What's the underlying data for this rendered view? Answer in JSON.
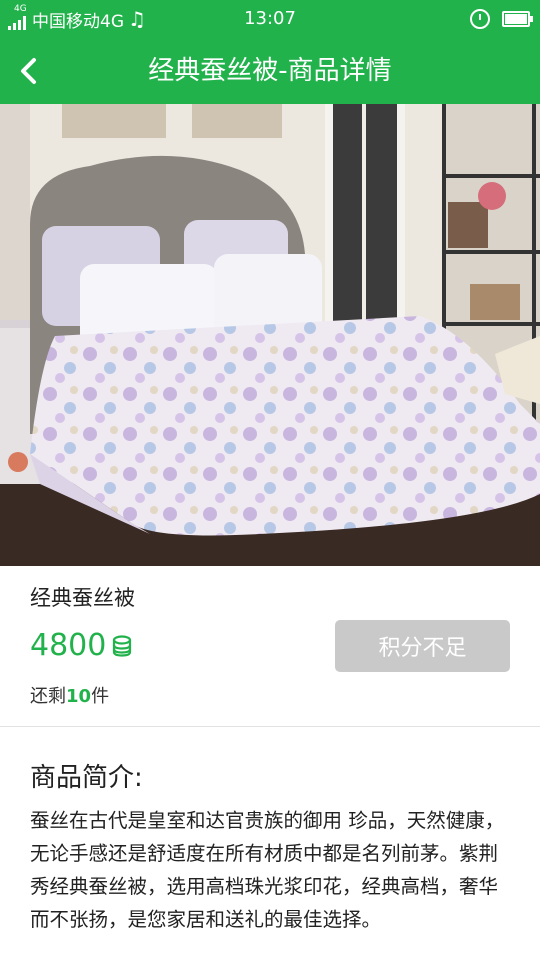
{
  "status_bar": {
    "network_small": "4G",
    "carrier": "中国移动4G",
    "time": "13:07"
  },
  "header": {
    "title": "经典蚕丝被-商品详情"
  },
  "product": {
    "name": "经典蚕丝被",
    "price": "4800",
    "stock_prefix": "还剩",
    "stock_count": "10",
    "stock_suffix": "件",
    "redeem_button": "积分不足"
  },
  "description": {
    "title": "商品简介:",
    "body": "蚕丝在古代是皇室和达官贵族的御用 珍品，天然健康，无论手感还是舒适度在所有材质中都是名列前茅。紫荆秀经典蚕丝被，选用高档珠光浆印花，经典高档，奢华而不张扬，是您家居和送礼的最佳选择。"
  },
  "colors": {
    "accent": "#22b24c",
    "disabled_button": "#c9c9c9"
  },
  "icons": {
    "back": "chevron-left-icon",
    "points": "coin-stack-icon",
    "alarm": "alarm-icon",
    "battery": "battery-icon",
    "signal": "signal-icon",
    "music": "music-note-icon"
  }
}
